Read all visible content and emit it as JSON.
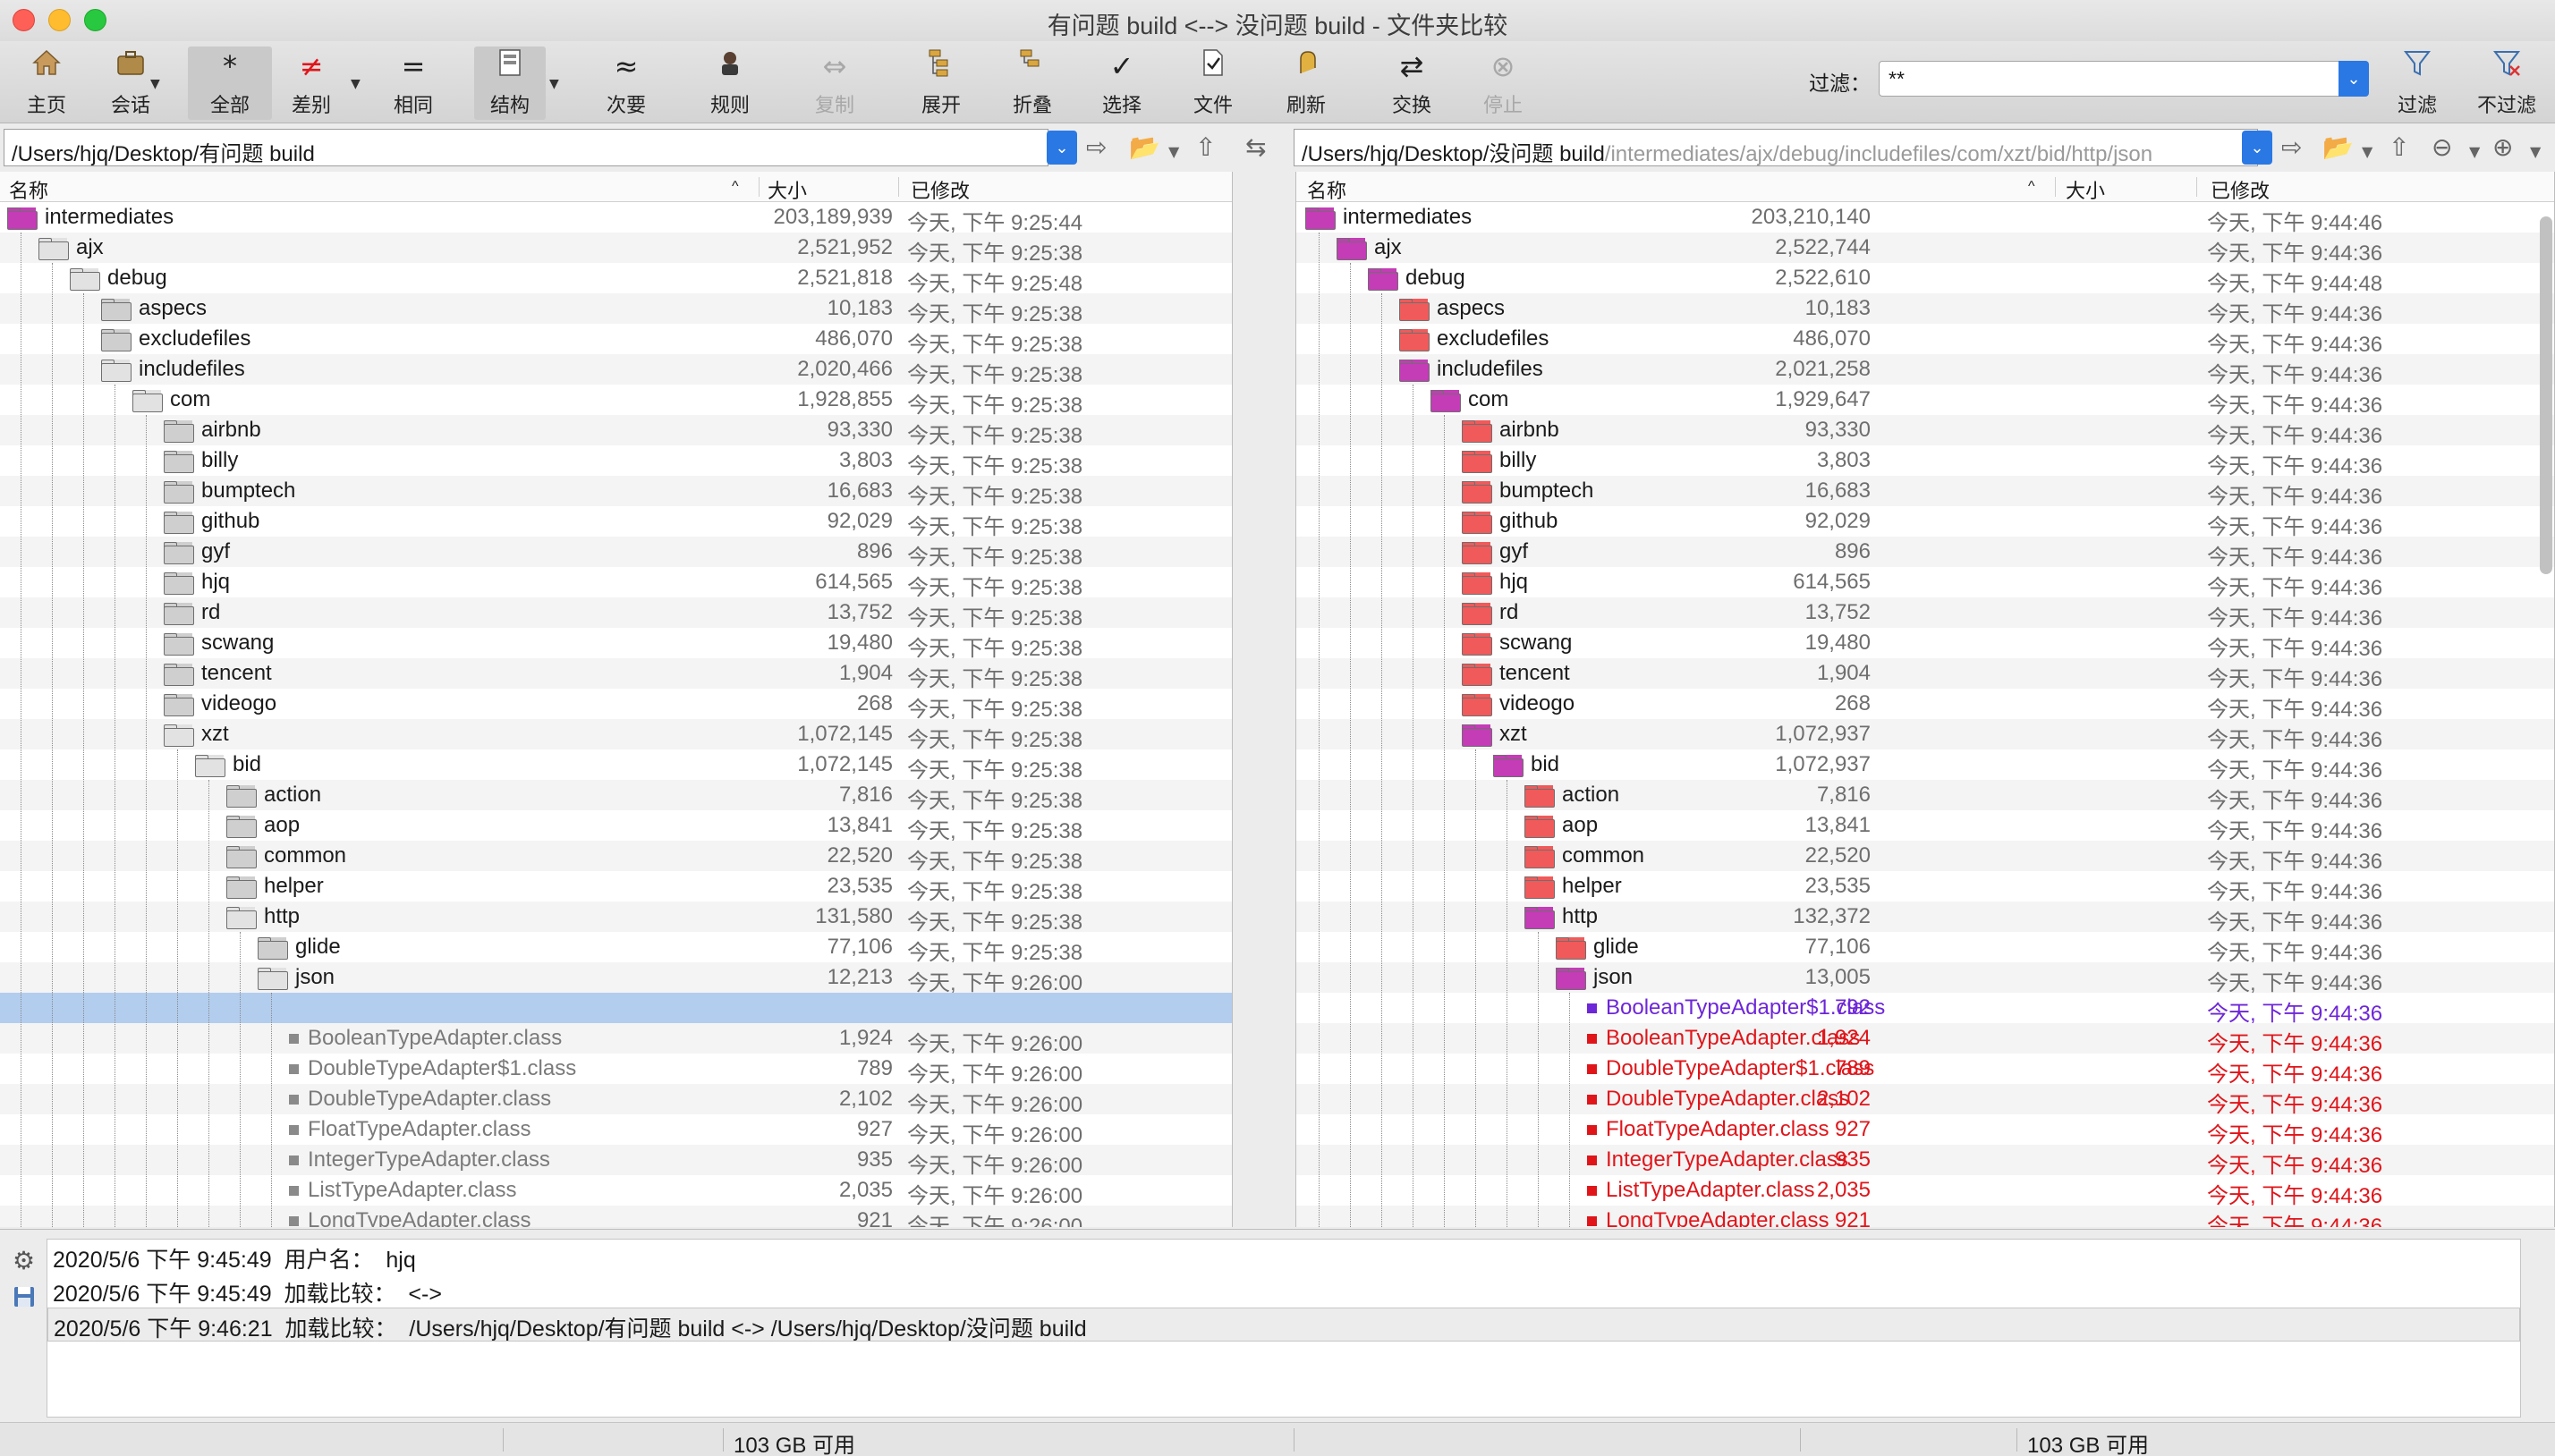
{
  "window": {
    "title": "有问题 build <--> 没问题 build - 文件夹比较"
  },
  "toolbar": {
    "items": [
      {
        "label": "主页",
        "icon": "home-icon"
      },
      {
        "label": "会话",
        "icon": "briefcase-icon"
      },
      {
        "label": "全部",
        "icon": "asterisk-icon",
        "glyph": "*"
      },
      {
        "label": "差别",
        "icon": "not-equal-icon",
        "glyph": "≠"
      },
      {
        "label": "相同",
        "icon": "equal-icon",
        "glyph": "="
      },
      {
        "label": "结构",
        "icon": "structure-icon"
      },
      {
        "label": "次要",
        "icon": "approx-equal-icon",
        "glyph": "≈"
      },
      {
        "label": "规则",
        "icon": "rules-icon"
      },
      {
        "label": "复制",
        "icon": "copy-arrows-icon",
        "glyph": "⇔"
      },
      {
        "label": "展开",
        "icon": "expand-icon"
      },
      {
        "label": "折叠",
        "icon": "collapse-icon"
      },
      {
        "label": "选择",
        "icon": "checkmark-icon",
        "glyph": "✓"
      },
      {
        "label": "文件",
        "icon": "file-check-icon"
      },
      {
        "label": "刷新",
        "icon": "refresh-icon"
      },
      {
        "label": "交换",
        "icon": "swap-icon",
        "glyph": "⇄"
      },
      {
        "label": "停止",
        "icon": "stop-icon",
        "glyph": "⊗"
      },
      {
        "label": "过滤",
        "icon": "filter-icon"
      },
      {
        "label": "不过滤",
        "icon": "no-filter-icon"
      }
    ],
    "filter_label": "过滤：",
    "filter_value": "**"
  },
  "left": {
    "path": "/Users/hjq/Desktop/有问题 build",
    "col_name": "名称",
    "col_size": "大小",
    "col_modified": "已修改",
    "rows": [
      {
        "name": "intermediates",
        "size": "203,189,939",
        "date": "今天, 下午 9:25:44"
      },
      {
        "name": "ajx",
        "size": "2,521,952",
        "date": "今天, 下午 9:25:38"
      },
      {
        "name": "debug",
        "size": "2,521,818",
        "date": "今天, 下午 9:25:48"
      },
      {
        "name": "aspecs",
        "size": "10,183",
        "date": "今天, 下午 9:25:38"
      },
      {
        "name": "excludefiles",
        "size": "486,070",
        "date": "今天, 下午 9:25:38"
      },
      {
        "name": "includefiles",
        "size": "2,020,466",
        "date": "今天, 下午 9:25:38"
      },
      {
        "name": "com",
        "size": "1,928,855",
        "date": "今天, 下午 9:25:38"
      },
      {
        "name": "airbnb",
        "size": "93,330",
        "date": "今天, 下午 9:25:38"
      },
      {
        "name": "billy",
        "size": "3,803",
        "date": "今天, 下午 9:25:38"
      },
      {
        "name": "bumptech",
        "size": "16,683",
        "date": "今天, 下午 9:25:38"
      },
      {
        "name": "github",
        "size": "92,029",
        "date": "今天, 下午 9:25:38"
      },
      {
        "name": "gyf",
        "size": "896",
        "date": "今天, 下午 9:25:38"
      },
      {
        "name": "hjq",
        "size": "614,565",
        "date": "今天, 下午 9:25:38"
      },
      {
        "name": "rd",
        "size": "13,752",
        "date": "今天, 下午 9:25:38"
      },
      {
        "name": "scwang",
        "size": "19,480",
        "date": "今天, 下午 9:25:38"
      },
      {
        "name": "tencent",
        "size": "1,904",
        "date": "今天, 下午 9:25:38"
      },
      {
        "name": "videogo",
        "size": "268",
        "date": "今天, 下午 9:25:38"
      },
      {
        "name": "xzt",
        "size": "1,072,145",
        "date": "今天, 下午 9:25:38"
      },
      {
        "name": "bid",
        "size": "1,072,145",
        "date": "今天, 下午 9:25:38"
      },
      {
        "name": "action",
        "size": "7,816",
        "date": "今天, 下午 9:25:38"
      },
      {
        "name": "aop",
        "size": "13,841",
        "date": "今天, 下午 9:25:38"
      },
      {
        "name": "common",
        "size": "22,520",
        "date": "今天, 下午 9:25:38"
      },
      {
        "name": "helper",
        "size": "23,535",
        "date": "今天, 下午 9:25:38"
      },
      {
        "name": "http",
        "size": "131,580",
        "date": "今天, 下午 9:25:38"
      },
      {
        "name": "glide",
        "size": "77,106",
        "date": "今天, 下午 9:25:38"
      },
      {
        "name": "json",
        "size": "12,213",
        "date": "今天, 下午 9:26:00"
      },
      {
        "name": "",
        "size": "",
        "date": ""
      },
      {
        "name": "BooleanTypeAdapter.class",
        "size": "1,924",
        "date": "今天, 下午 9:26:00"
      },
      {
        "name": "DoubleTypeAdapter$1.class",
        "size": "789",
        "date": "今天, 下午 9:26:00"
      },
      {
        "name": "DoubleTypeAdapter.class",
        "size": "2,102",
        "date": "今天, 下午 9:26:00"
      },
      {
        "name": "FloatTypeAdapter.class",
        "size": "927",
        "date": "今天, 下午 9:26:00"
      },
      {
        "name": "IntegerTypeAdapter.class",
        "size": "935",
        "date": "今天, 下午 9:26:00"
      },
      {
        "name": "ListTypeAdapter.class",
        "size": "2,035",
        "date": "今天, 下午 9:26:00"
      },
      {
        "name": "LongTypeAdapter.class",
        "size": "921",
        "date": "今天, 下午 9:26:00"
      }
    ]
  },
  "right": {
    "path_base": "/Users/hjq/Desktop/没问题 build",
    "path_rest": "/intermediates/ajx/debug/includefiles/com/xzt/bid/http/json",
    "col_name": "名称",
    "col_size": "大小",
    "col_modified": "已修改",
    "rows": [
      {
        "name": "intermediates",
        "size": "203,210,140",
        "date": "今天, 下午 9:44:46"
      },
      {
        "name": "ajx",
        "size": "2,522,744",
        "date": "今天, 下午 9:44:36"
      },
      {
        "name": "debug",
        "size": "2,522,610",
        "date": "今天, 下午 9:44:48"
      },
      {
        "name": "aspecs",
        "size": "10,183",
        "date": "今天, 下午 9:44:36"
      },
      {
        "name": "excludefiles",
        "size": "486,070",
        "date": "今天, 下午 9:44:36"
      },
      {
        "name": "includefiles",
        "size": "2,021,258",
        "date": "今天, 下午 9:44:36"
      },
      {
        "name": "com",
        "size": "1,929,647",
        "date": "今天, 下午 9:44:36"
      },
      {
        "name": "airbnb",
        "size": "93,330",
        "date": "今天, 下午 9:44:36"
      },
      {
        "name": "billy",
        "size": "3,803",
        "date": "今天, 下午 9:44:36"
      },
      {
        "name": "bumptech",
        "size": "16,683",
        "date": "今天, 下午 9:44:36"
      },
      {
        "name": "github",
        "size": "92,029",
        "date": "今天, 下午 9:44:36"
      },
      {
        "name": "gyf",
        "size": "896",
        "date": "今天, 下午 9:44:36"
      },
      {
        "name": "hjq",
        "size": "614,565",
        "date": "今天, 下午 9:44:36"
      },
      {
        "name": "rd",
        "size": "13,752",
        "date": "今天, 下午 9:44:36"
      },
      {
        "name": "scwang",
        "size": "19,480",
        "date": "今天, 下午 9:44:36"
      },
      {
        "name": "tencent",
        "size": "1,904",
        "date": "今天, 下午 9:44:36"
      },
      {
        "name": "videogo",
        "size": "268",
        "date": "今天, 下午 9:44:36"
      },
      {
        "name": "xzt",
        "size": "1,072,937",
        "date": "今天, 下午 9:44:36"
      },
      {
        "name": "bid",
        "size": "1,072,937",
        "date": "今天, 下午 9:44:36"
      },
      {
        "name": "action",
        "size": "7,816",
        "date": "今天, 下午 9:44:36"
      },
      {
        "name": "aop",
        "size": "13,841",
        "date": "今天, 下午 9:44:36"
      },
      {
        "name": "common",
        "size": "22,520",
        "date": "今天, 下午 9:44:36"
      },
      {
        "name": "helper",
        "size": "23,535",
        "date": "今天, 下午 9:44:36"
      },
      {
        "name": "http",
        "size": "132,372",
        "date": "今天, 下午 9:44:36"
      },
      {
        "name": "glide",
        "size": "77,106",
        "date": "今天, 下午 9:44:36"
      },
      {
        "name": "json",
        "size": "13,005",
        "date": "今天, 下午 9:44:36"
      },
      {
        "name": "BooleanTypeAdapter$1.class",
        "size": "792",
        "date": "今天, 下午 9:44:36"
      },
      {
        "name": "BooleanTypeAdapter.class",
        "size": "1,924",
        "date": "今天, 下午 9:44:36"
      },
      {
        "name": "DoubleTypeAdapter$1.class",
        "size": "789",
        "date": "今天, 下午 9:44:36"
      },
      {
        "name": "DoubleTypeAdapter.class",
        "size": "2,102",
        "date": "今天, 下午 9:44:36"
      },
      {
        "name": "FloatTypeAdapter.class",
        "size": "927",
        "date": "今天, 下午 9:44:36"
      },
      {
        "name": "IntegerTypeAdapter.class",
        "size": "935",
        "date": "今天, 下午 9:44:36"
      },
      {
        "name": "ListTypeAdapter.class",
        "size": "2,035",
        "date": "今天, 下午 9:44:36"
      },
      {
        "name": "LongTypeAdapter.class",
        "size": "921",
        "date": "今天, 下午 9:44:36"
      }
    ]
  },
  "log": {
    "lines": [
      "2020/5/6 下午 9:45:49  用户名：  hjq",
      "2020/5/6 下午 9:45:49  加载比较：  <->",
      "2020/5/6 下午 9:46:21  加载比较：  /Users/hjq/Desktop/有问题 build <-> /Users/hjq/Desktop/没问题 build"
    ]
  },
  "status": {
    "left_free": "103 GB 可用",
    "right_free": "103 GB 可用"
  },
  "colors": {
    "diff": "#e0151a",
    "orphan": "#6d26d8",
    "selection": "#b3cdef",
    "accent": "#2a78e4"
  }
}
